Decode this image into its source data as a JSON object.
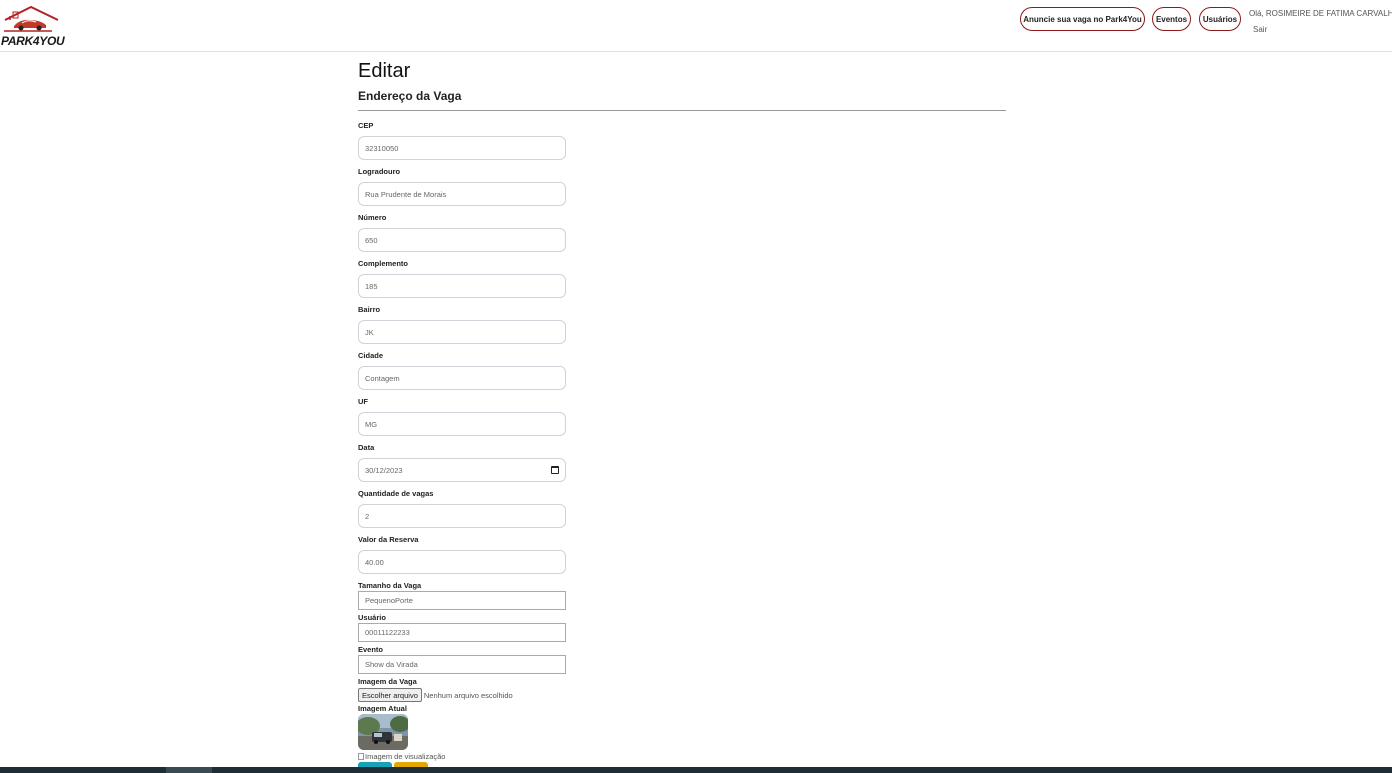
{
  "header": {
    "logo_text": "PARK4YOU",
    "nav": [
      "Anuncie sua vaga no Park4You",
      "Eventos",
      "Usuários"
    ],
    "greeting": "Olá, ROSIMEIRE DE FATIMA CARVALHO",
    "logout": "Sair",
    "accent_color": "#8b1a1a"
  },
  "page": {
    "title": "Editar",
    "section": "Endereço da Vaga"
  },
  "form": {
    "cep": {
      "label": "CEP",
      "value": "32310050"
    },
    "logradouro": {
      "label": "Logradouro",
      "value": "Rua Prudente de Morais"
    },
    "numero": {
      "label": "Número",
      "value": "650"
    },
    "complemento": {
      "label": "Complemento",
      "value": "185"
    },
    "bairro": {
      "label": "Bairro",
      "value": "JK"
    },
    "cidade": {
      "label": "Cidade",
      "value": "Contagem"
    },
    "uf": {
      "label": "UF",
      "value": "MG"
    },
    "data": {
      "label": "Data",
      "value": "30/12/2023"
    },
    "quantidade": {
      "label": "Quantidade de vagas",
      "value": "2"
    },
    "valor": {
      "label": "Valor da Reserva",
      "value": "40.00"
    },
    "tamanho": {
      "label": "Tamanho da Vaga",
      "value": "PequenoPorte"
    },
    "usuario": {
      "label": "Usuário",
      "value": "00011122233"
    },
    "evento": {
      "label": "Evento",
      "value": "Show da Virada"
    },
    "imagem": {
      "label": "Imagem da Vaga",
      "button": "Escolher arquivo",
      "status": "Nenhum arquivo escolhido"
    },
    "imagem_atual": {
      "label": "Imagem Atual",
      "preview_alt": "Imagem de visualização"
    }
  },
  "colors": {
    "save_button": "#17a2b8",
    "back_button": "#e0a800"
  }
}
